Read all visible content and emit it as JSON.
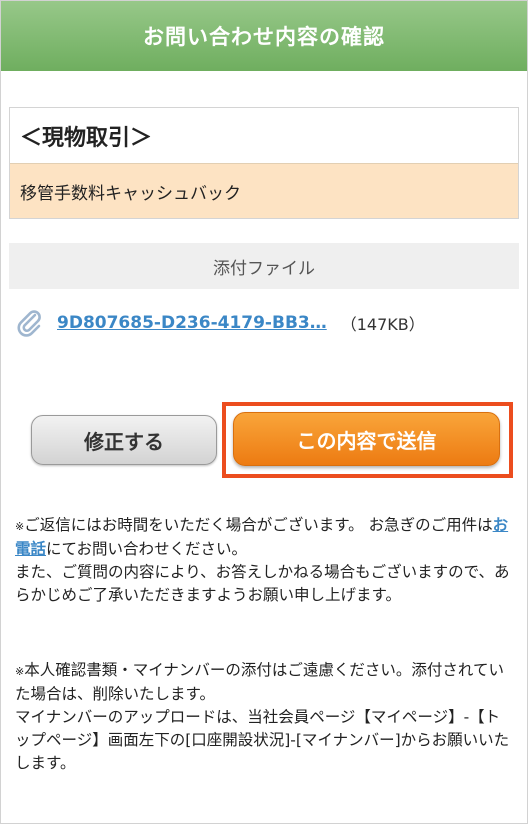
{
  "header": {
    "title": "お問い合わせ内容の確認"
  },
  "category": {
    "title": "＜現物取引＞",
    "value": "移管手数料キャッシュバック"
  },
  "attachment": {
    "header": "添付ファイル",
    "icon": "paperclip-icon",
    "filename": "9D807685-D236-4179-BB3…",
    "size": "（147KB）"
  },
  "buttons": {
    "fix_label": "修正する",
    "send_label": "この内容で送信"
  },
  "notes": {
    "note1_mark": "※",
    "note1_part1": "ご返信にはお時間をいただく場合がございます。 お急ぎのご用件は",
    "note1_link": "お電話",
    "note1_part2": "にてお問い合わせください。",
    "note1_line2": "また、ご質問の内容により、お答えしかねる場合もございますので、あらかじめご了承いただきますようお願い申し上げます。",
    "note2_mark": "※",
    "note2_part1": "本人確認書類・マイナンバーの添付はご遠慮ください。添付されていた場合は、削除いたします。",
    "note2_line2": "マイナンバーのアップロードは、当社会員ページ【マイページ】-【トップページ】画面左下の[口座開設状況]-[マイナンバー]からお願いいたします。"
  },
  "colors": {
    "header_green": "#7db86e",
    "send_orange": "#f08a1c",
    "highlight_red": "#ec4d1e",
    "link_blue": "#3b87c6",
    "category_bg": "#fde3c3"
  }
}
